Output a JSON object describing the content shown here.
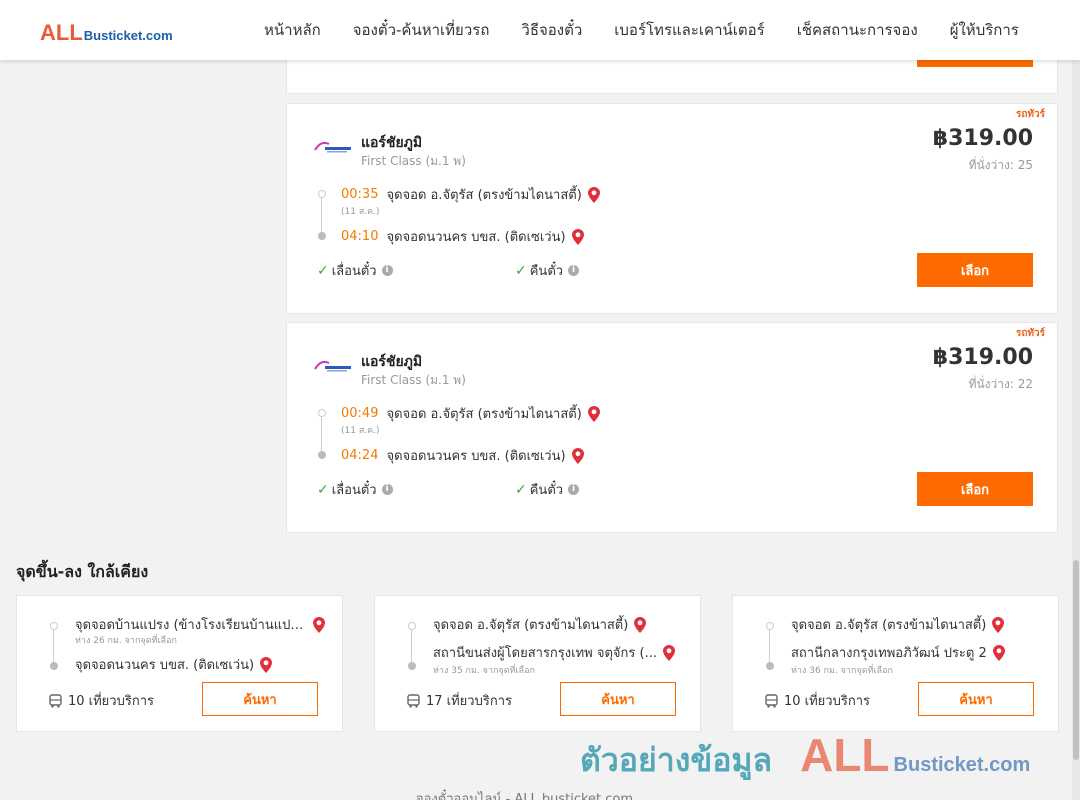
{
  "header": {
    "logo_all": "ALL",
    "logo_busticket": "Busticket.com",
    "nav": [
      "หน้าหลัก",
      "จองตั๋ว-ค้นหาเที่ยวรถ",
      "วิธีจองตั๋ว",
      "เบอร์โทรและเคาน์เตอร์",
      "เช็คสถานะการจอง",
      "ผู้ให้บริการ"
    ]
  },
  "trips": [
    {
      "badge": "รถทัวร์",
      "operator": "แอร์ชัยภูมิ",
      "class": "First Class (ม.1 พ)",
      "price": "฿319.00",
      "seats": "ที่นั่งว่าง: 25",
      "dep_time": "00:35",
      "dep_stop": "จุดจอด อ.จัตุรัส (ตรงข้ามไดนาสตี้)",
      "dep_date": "(11 ส.ค.)",
      "arr_time": "04:10",
      "arr_stop": "จุดจอดนวนคร บขส. (ติดเซเว่น)",
      "feature1": "เลื่อนตั๋ว",
      "feature2": "คืนตั๋ว",
      "select": "เลือก"
    },
    {
      "badge": "รถทัวร์",
      "operator": "แอร์ชัยภูมิ",
      "class": "First Class (ม.1 พ)",
      "price": "฿319.00",
      "seats": "ที่นั่งว่าง: 22",
      "dep_time": "00:49",
      "dep_stop": "จุดจอด อ.จัตุรัส (ตรงข้ามไดนาสตี้)",
      "dep_date": "(11 ส.ค.)",
      "arr_time": "04:24",
      "arr_stop": "จุดจอดนวนคร บขส. (ติดเซเว่น)",
      "feature1": "เลื่อนตั๋ว",
      "feature2": "คืนตั๋ว",
      "select": "เลือก"
    }
  ],
  "nearby": {
    "title": "จุดขึ้น-ลง ใกล้เคียง",
    "cards": [
      {
        "from": "จุดจอดบ้านแปรง (ข้างโรงเรียนบ้านแปร...",
        "from_dist": "ห่าง 26 กม. จากจุดที่เลือก",
        "to": "จุดจอดนวนคร บขส. (ติดเซเว่น)",
        "to_dist": "",
        "trips": "10 เที่ยวบริการ",
        "search": "ค้นหา"
      },
      {
        "from": "จุดจอด อ.จัตุรัส (ตรงข้ามไดนาสตี้)",
        "from_dist": "",
        "to": "สถานีขนส่งผู้โดยสารกรุงเทพ จตุจักร (...",
        "to_dist": "ห่าง 35 กม. จากจุดที่เลือก",
        "trips": "17 เที่ยวบริการ",
        "search": "ค้นหา"
      },
      {
        "from": "จุดจอด อ.จัตุรัส (ตรงข้ามไดนาสตี้)",
        "from_dist": "",
        "to": "สถานีกลางกรุงเทพอภิวัฒน์ ประตู 2",
        "to_dist": "ห่าง 36 กม. จากจุดที่เลือก",
        "trips": "10 เที่ยวบริการ",
        "search": "ค้นหา"
      }
    ]
  },
  "watermark": {
    "thai": "ตัวอย่างข้อมูล",
    "all": "ALL",
    "busticket": "Busticket.com"
  },
  "footer": "จองตั๋วออนไลน์ - ALL busticket.com",
  "colors": {
    "accent": "#ff6a00",
    "time": "#f07c00",
    "check": "#3aa845",
    "logo_red": "#e85a3a",
    "logo_blue": "#1d5ea8",
    "pin": "#e0303a"
  }
}
